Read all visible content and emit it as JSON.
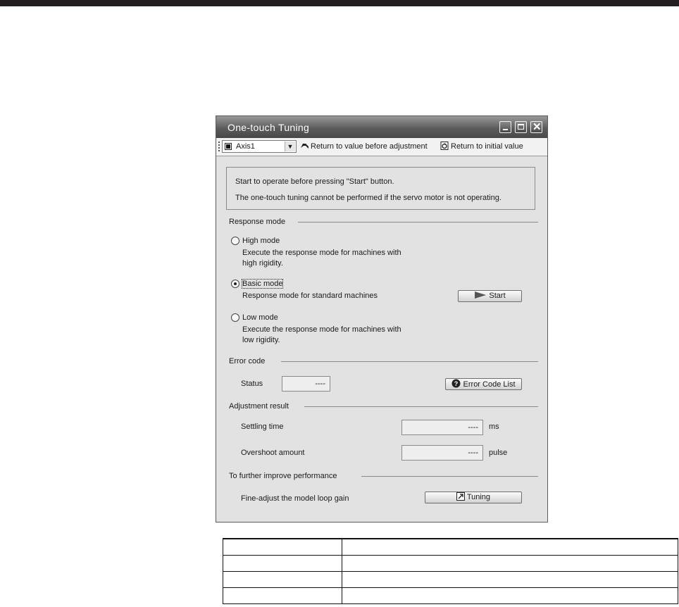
{
  "window": {
    "title": "One-touch Tuning",
    "controls": {
      "minimize": "minimize-icon",
      "maximize": "maximize-icon",
      "close": "close-icon"
    }
  },
  "toolbar": {
    "axis_value": "Axis1",
    "return_before_label": "Return to value before adjustment",
    "return_initial_label": "Return to initial value"
  },
  "info": {
    "line1": "Start to operate before pressing \"Start\" button.",
    "line2": "The one-touch tuning cannot be performed if the servo motor is not operating."
  },
  "response_mode": {
    "heading": "Response mode",
    "selected": "Basic mode",
    "options": [
      {
        "label": "High mode",
        "desc1": "Execute the response mode for machines with",
        "desc2": "high rigidity."
      },
      {
        "label": "Basic mode",
        "desc1": "Response mode for standard machines",
        "desc2": ""
      },
      {
        "label": "Low mode",
        "desc1": "Execute the response mode for machines with",
        "desc2": "low rigidity."
      }
    ],
    "start_label": "Start"
  },
  "error_code": {
    "heading": "Error code",
    "status_label": "Status",
    "status_value": "----",
    "list_button": "Error Code List"
  },
  "adjustment_result": {
    "heading": "Adjustment result",
    "settling_label": "Settling time",
    "settling_value": "----",
    "settling_unit": "ms",
    "overshoot_label": "Overshoot amount",
    "overshoot_value": "----",
    "overshoot_unit": "pulse"
  },
  "improve": {
    "heading": "To further improve performance",
    "finetune_label": "Fine-adjust the model loop gain",
    "tuning_button": "Tuning"
  },
  "colors": {
    "page_bg": "#ffffff",
    "window_bg": "#e2e2e2",
    "titlebar": "#5c5c5c",
    "top_rule": "#231f20"
  }
}
